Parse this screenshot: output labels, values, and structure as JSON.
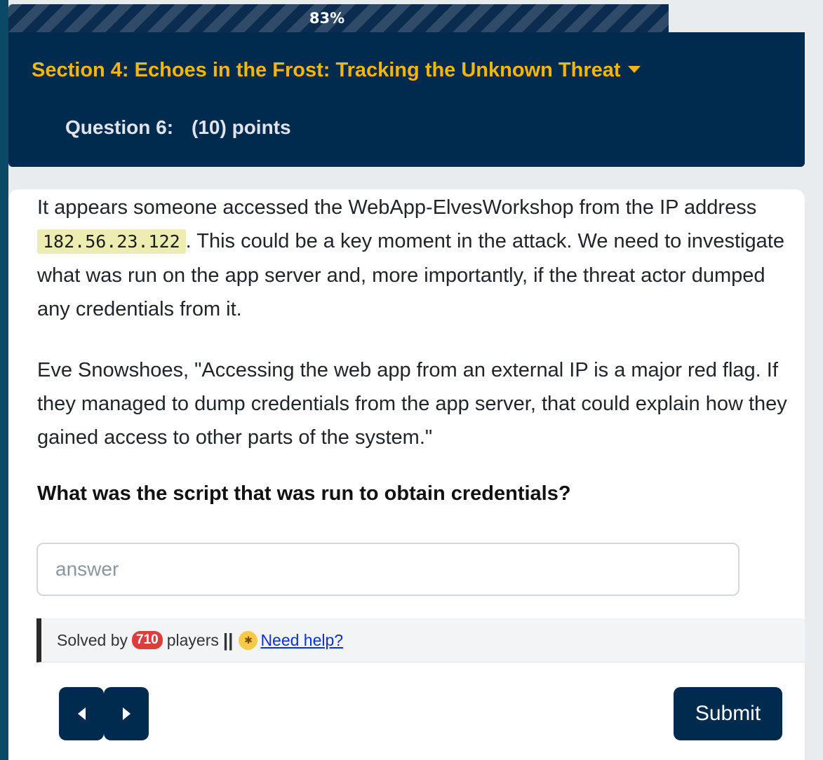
{
  "progress": {
    "percent": 83,
    "label": "83%"
  },
  "header": {
    "section_title": "Section 4: Echoes in the Frost: Tracking the Unknown Threat",
    "question_label": "Question 6:",
    "points_label": "(10) points"
  },
  "content": {
    "p1_before": "It appears someone accessed the WebApp-ElvesWorkshop from the IP address ",
    "ip": "182.56.23.122",
    "p1_after": ". This could be a key moment in the attack. We need to investigate what was run on the app server and, more importantly, if the threat actor dumped any credentials from it.",
    "p2": "Eve Snowshoes, \"Accessing the web app from an external IP is a major red flag. If they managed to dump credentials from the app server, that could explain how they gained access to other parts of the system.\"",
    "question": "What was the script that was run to obtain credentials?"
  },
  "answer": {
    "placeholder": "answer",
    "value": ""
  },
  "solved": {
    "prefix": "Solved by",
    "count": "710",
    "suffix": "players",
    "separator": "||",
    "help_icon": "dizzy-face-emoji",
    "help_label": "Need help?"
  },
  "nav": {
    "prev_icon": "caret-left-icon",
    "next_icon": "caret-right-icon"
  },
  "submit_label": "Submit",
  "colors": {
    "navy": "#012a4f",
    "gold": "#f2b705",
    "badge_red": "#dc3d3d",
    "ip_highlight": "#ecedb0",
    "link_blue": "#0a31d8"
  }
}
